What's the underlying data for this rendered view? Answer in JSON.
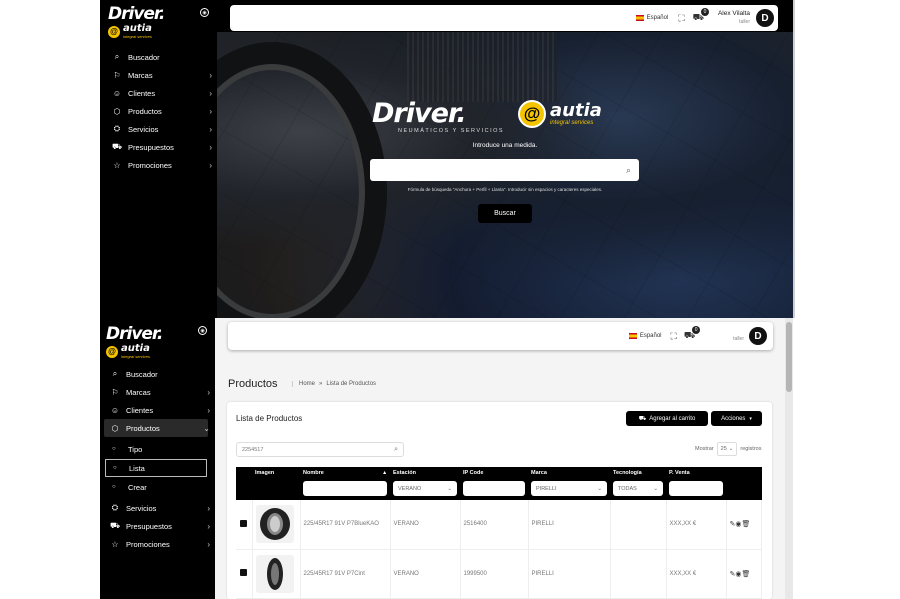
{
  "brand": {
    "driver": "Driver.",
    "autia": "autia",
    "autia_sub": "integral services",
    "hero_tagline": "NEUMÁTICOS Y SERVICIOS",
    "at_symbol": "@"
  },
  "user": {
    "name": "Alex Vilalta",
    "role": "taller",
    "avatar_letter": "D",
    "language": "Español",
    "cart_count": "0"
  },
  "sidebar": {
    "items": [
      {
        "label": "Buscador",
        "icon": "search-icon",
        "glyph": "⌕"
      },
      {
        "label": "Marcas",
        "icon": "flag-icon",
        "glyph": "⚐"
      },
      {
        "label": "Clientes",
        "icon": "user-icon",
        "glyph": "☺"
      },
      {
        "label": "Productos",
        "icon": "box-icon",
        "glyph": "⬡"
      },
      {
        "label": "Servicios",
        "icon": "car-icon",
        "glyph": "⛭"
      },
      {
        "label": "Presupuestos",
        "icon": "cart-icon",
        "glyph": "⛟"
      },
      {
        "label": "Promociones",
        "icon": "star-icon",
        "glyph": "☆"
      }
    ],
    "sub_items": [
      "Tipo",
      "Lista",
      "Crear"
    ]
  },
  "hero": {
    "prompt": "Introduce una medida.",
    "search_value": "",
    "hint": "Fórmula de búsqueda \"Anchura + Perfil + Llanta\". Introducir sin espacios y caracteres especiales.",
    "button": "Buscar"
  },
  "products_page": {
    "title": "Productos",
    "breadcrumb_home": "Home",
    "breadcrumb_sep": "»",
    "breadcrumb_current": "Lista de Productos",
    "card_title": "Lista de Productos",
    "add_cart_button": "Agregar al carrito",
    "actions_button": "Acciones",
    "search_value": "2254517",
    "show_label": "Mostrar",
    "show_value": "25",
    "records_label": "registros",
    "columns": [
      "Imagen",
      "Nombre",
      "Estación",
      "IP Code",
      "Marca",
      "Tecnología",
      "P. Venta"
    ],
    "filters": {
      "estacion": "VERANO",
      "marca": "PIRELLI",
      "tecnologia": "TODAS"
    },
    "rows": [
      {
        "name": "225/45R17 91V P7BlueKAO",
        "season": "VERANO",
        "ipcode": "2516400",
        "brand": "PIRELLI",
        "tech": "",
        "price": "XXX,XX €"
      },
      {
        "name": "225/45R17 91V P7Cint",
        "season": "VERANO",
        "ipcode": "1999500",
        "brand": "PIRELLI",
        "tech": "",
        "price": "XXX,XX €"
      }
    ]
  },
  "colors": {
    "sidebar": "#000000",
    "accent": "#f5c400",
    "flag_red": "#c60b1e"
  }
}
